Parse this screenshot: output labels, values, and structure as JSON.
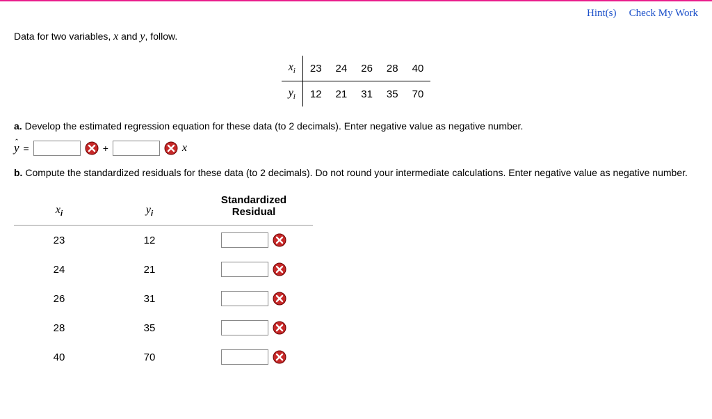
{
  "top": {
    "hints": "Hint(s)",
    "check": "Check My Work"
  },
  "intro_pre": "Data for two variables, ",
  "intro_var1": "x",
  "intro_and": " and ",
  "intro_var2": "y",
  "intro_post": ", follow.",
  "dt": {
    "xi_label": "x",
    "yi_label": "y",
    "x": [
      "23",
      "24",
      "26",
      "28",
      "40"
    ],
    "y": [
      "12",
      "21",
      "31",
      "35",
      "70"
    ]
  },
  "partA": {
    "label": "a.",
    "text": " Develop the estimated regression equation for these data (to 2 decimals). Enter negative value as negative number."
  },
  "eq": {
    "yhat": "y",
    "equals": "=",
    "plus": "+",
    "xvar": "x"
  },
  "partB": {
    "label": "b.",
    "text": " Compute the standardized residuals for these data (to 2 decimals). Do not round your intermediate calculations. Enter negative value as negative number."
  },
  "rtable": {
    "col_x": "x",
    "col_y": "y",
    "col_r1": "Standardized",
    "col_r2": "Residual",
    "rows": [
      {
        "x": "23",
        "y": "12"
      },
      {
        "x": "24",
        "y": "21"
      },
      {
        "x": "26",
        "y": "31"
      },
      {
        "x": "28",
        "y": "35"
      },
      {
        "x": "40",
        "y": "70"
      }
    ]
  }
}
